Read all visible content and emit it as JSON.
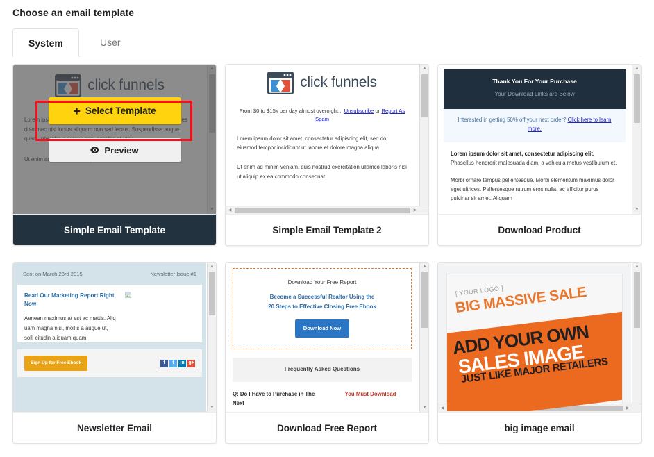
{
  "heading": "Choose an email template",
  "tabs": [
    {
      "label": "System",
      "active": true
    },
    {
      "label": "User",
      "active": false
    }
  ],
  "overlay": {
    "select_label": "Select Template",
    "preview_label": "Preview",
    "plus_icon": "plus-icon",
    "eye_icon": "eye-icon",
    "highlight_color": "#fc0d1b",
    "select_bg": "#ffd30d"
  },
  "colors": {
    "selected_footer_bg": "#23323f",
    "brand_navy": "#1f2f3d",
    "link_blue": "#2222cc",
    "orange": "#ec6a20"
  },
  "cards": [
    {
      "name": "Simple Email Template",
      "selected": true,
      "brand_word": "click funnels"
    },
    {
      "name": "Simple Email Template 2",
      "selected": false,
      "brand_word": "click funnels",
      "lead_text": "From $0 to $15k per day almost overnight...",
      "lead_link_1": "Unsubscribe",
      "lead_or": "or",
      "lead_link_2": "Report As Spam",
      "para_1": "Lorem ipsum dolor sit amet, consectetur adipiscing elit, sed do eiusmod tempor incididunt ut labore et dolore magna aliqua.",
      "para_2": "Ut enim ad minim veniam, quis nostrud exercitation ullamco laboris nisi ut aliquip ex ea commodo consequat."
    },
    {
      "name": "Download Product",
      "selected": false,
      "head_title": "Thank You For Your Purchase",
      "head_sub": "Your Download Links are Below",
      "offer_text": "Interested in getting 50% off your next order?",
      "offer_link": "Click here to learn more.",
      "para_1_bold": "Lorem ipsum dolor sit amet, consectetur adipiscing elit.",
      "para_1_rest": " Phasellus hendrerit malesuada diam, a vehicula metus vestibulum et.",
      "para_2": "Morbi ornare tempus pellentesque. Morbi elementum maximus dolor eget ultrices. Pellentesque rutrum eros nulla, ac efficitur purus pulvinar sit amet. Aliquam"
    },
    {
      "name": "Newsletter Email",
      "selected": false,
      "sent_on": "Sent on March 23rd 2015",
      "issue": "Newsletter Issue #1",
      "headline": "Read Our Marketing Report Right Now",
      "body": "Aenean maximus at est ac mattis. Aliq uam magna nisi, mollis a augue ut, solli citudin aliquam quam.",
      "cta_label": "Sign Up for Free Ebook",
      "social": [
        "facebook-icon",
        "twitter-icon",
        "linkedin-icon",
        "googleplus-icon"
      ]
    },
    {
      "name": "Download Free Report",
      "selected": false,
      "box_title": "Download Your Free Report",
      "box_sub_line1": "Become a Successful Realtor Using the",
      "box_sub_line2": "20 Steps to Effective Closing Free Ebook",
      "box_button": "Download Now",
      "faq_title": "Frequently Asked Questions",
      "question": "Q: Do I Have to Purchase in The Next",
      "answer": "You Must Download"
    },
    {
      "name": "big image email",
      "selected": false,
      "logo_placeholder": "[ YOUR LOGO ]",
      "line_sale": "BIG MASSIVE SALE",
      "line_1": "ADD YOUR OWN",
      "line_2": "SALES IMAGE",
      "line_3": "JUST LIKE MAJOR RETAILERS"
    }
  ]
}
